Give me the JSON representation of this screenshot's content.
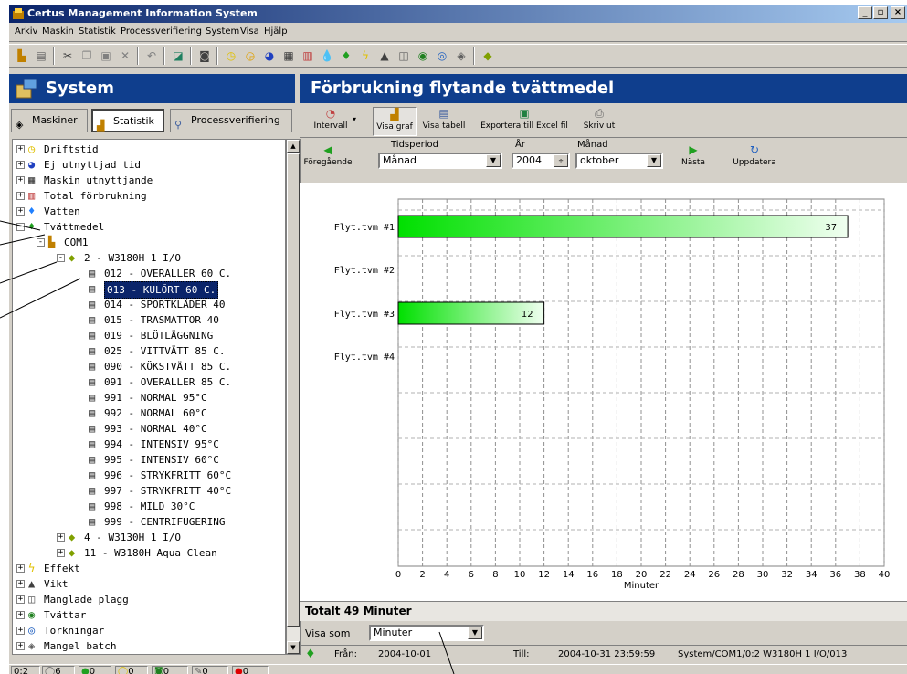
{
  "window": {
    "title": "Certus Management Information System"
  },
  "menu": [
    "Arkiv",
    "Maskin",
    "Statistik",
    "Processverifiering",
    "System",
    "Visa",
    "Hjälp"
  ],
  "left_header": {
    "title": "System"
  },
  "tabs": {
    "maskiner": "Maskiner",
    "statistik": "Statistik",
    "processverifiering": "Processverifiering"
  },
  "tree": {
    "items": [
      {
        "label": "Driftstid",
        "icon": "clock-icon",
        "color": "#e0c000"
      },
      {
        "label": "Ej utnyttjad tid",
        "icon": "pie-icon",
        "color": "#2040c0"
      },
      {
        "label": "Maskin utnyttjande",
        "icon": "grid-icon",
        "color": "#404040"
      },
      {
        "label": "Total förbrukning",
        "icon": "table-icon",
        "color": "#c04040"
      },
      {
        "label": "Vatten",
        "icon": "water-drop-icon",
        "color": "#2080ff"
      },
      {
        "label": "Tvättmedel",
        "icon": "detergent-drop-icon",
        "color": "#20a020"
      },
      {
        "label": "COM1",
        "icon": "network-icon",
        "color": "#c08000"
      },
      {
        "label": "2 - W3180H 1 I/O",
        "icon": "machine-icon",
        "color": "#80a000"
      },
      {
        "label": "012 - OVERALLER 60 C.",
        "icon": "program-icon"
      },
      {
        "label": "013 - KULÖRT 60 C.",
        "icon": "program-icon",
        "selected": true
      },
      {
        "label": "014 - SPORTKLÄDER 40",
        "icon": "program-icon"
      },
      {
        "label": "015 - TRASMATTOR 40",
        "icon": "program-icon"
      },
      {
        "label": "019 - BLÖTLÄGGNING",
        "icon": "program-icon"
      },
      {
        "label": "025 - VITTVÄTT 85 C.",
        "icon": "program-icon"
      },
      {
        "label": "090 - KÖKSTVÄTT 85 C.",
        "icon": "program-icon"
      },
      {
        "label": "091 - OVERALLER 85 C.",
        "icon": "program-icon"
      },
      {
        "label": "991 - NORMAL 95°C",
        "icon": "program-icon"
      },
      {
        "label": "992 - NORMAL 60°C",
        "icon": "program-icon"
      },
      {
        "label": "993 - NORMAL 40°C",
        "icon": "program-icon"
      },
      {
        "label": "994 - INTENSIV 95°C",
        "icon": "program-icon"
      },
      {
        "label": "995 - INTENSIV 60°C",
        "icon": "program-icon"
      },
      {
        "label": "996 - STRYKFRITT 60°C",
        "icon": "program-icon"
      },
      {
        "label": "997 - STRYKFRITT 40°C",
        "icon": "program-icon"
      },
      {
        "label": "998 - MILD 30°C",
        "icon": "program-icon"
      },
      {
        "label": "999 - CENTRIFUGERING",
        "icon": "program-icon"
      },
      {
        "label": "4 - W3130H 1 I/O",
        "icon": "machine-icon",
        "color": "#80a000"
      },
      {
        "label": "11 - W3180H Aqua Clean",
        "icon": "machine-icon",
        "color": "#80a000"
      },
      {
        "label": "Effekt",
        "icon": "lightning-icon",
        "color": "#e0c000"
      },
      {
        "label": "Vikt",
        "icon": "weight-icon",
        "color": "#404040"
      },
      {
        "label": "Manglade plagg",
        "icon": "mangle-icon",
        "color": "#606060"
      },
      {
        "label": "Tvättar",
        "icon": "washer-icon",
        "color": "#208020"
      },
      {
        "label": "Torkningar",
        "icon": "dryer-icon",
        "color": "#2060c0"
      },
      {
        "label": "Mangel batch",
        "icon": "batch-icon",
        "color": "#606060"
      }
    ]
  },
  "right_header": {
    "title": "Förbrukning flytande tvättmedel"
  },
  "rtoolbar": {
    "intervall": "Intervall",
    "visa_graf": "Visa graf",
    "visa_tabell": "Visa tabell",
    "exportera": "Exportera till Excel fil",
    "skriv_ut": "Skriv ut"
  },
  "controls": {
    "foregaende": "Föregående",
    "tidsperiod_label": "Tidsperiod",
    "tidsperiod_value": "Månad",
    "ar_label": "År",
    "ar_value": "2004",
    "manad_label": "Månad",
    "manad_value": "oktober",
    "nasta": "Nästa",
    "uppdatera": "Uppdatera"
  },
  "chart_data": {
    "type": "bar",
    "orientation": "horizontal",
    "categories": [
      "Flyt.tvm #1",
      "Flyt.tvm #2",
      "Flyt.tvm #3",
      "Flyt.tvm #4"
    ],
    "values": [
      37,
      0,
      12,
      0
    ],
    "value_labels": [
      "37",
      "",
      "12",
      ""
    ],
    "xlabel": "Minuter",
    "xlim": [
      0,
      40
    ],
    "xticks": [
      0,
      2,
      4,
      6,
      8,
      10,
      12,
      14,
      16,
      18,
      20,
      22,
      24,
      26,
      28,
      30,
      32,
      34,
      36,
      38,
      40
    ],
    "grid": true,
    "bar_color": "#00e000"
  },
  "total": "Totalt 49 Minuter",
  "visa_som": {
    "label": "Visa som",
    "value": "Minuter"
  },
  "status": {
    "fran_label": "Från:",
    "fran_value": "2004-10-01",
    "till_label": "Till:",
    "till_value": "2004-10-31 23:59:59",
    "path": "System/COM1/0:2 W3180H 1 I/O/013"
  },
  "bottom_status": {
    "port": "0:2",
    "counts": [
      "6",
      "0",
      "0",
      "0",
      "0",
      "0"
    ]
  }
}
